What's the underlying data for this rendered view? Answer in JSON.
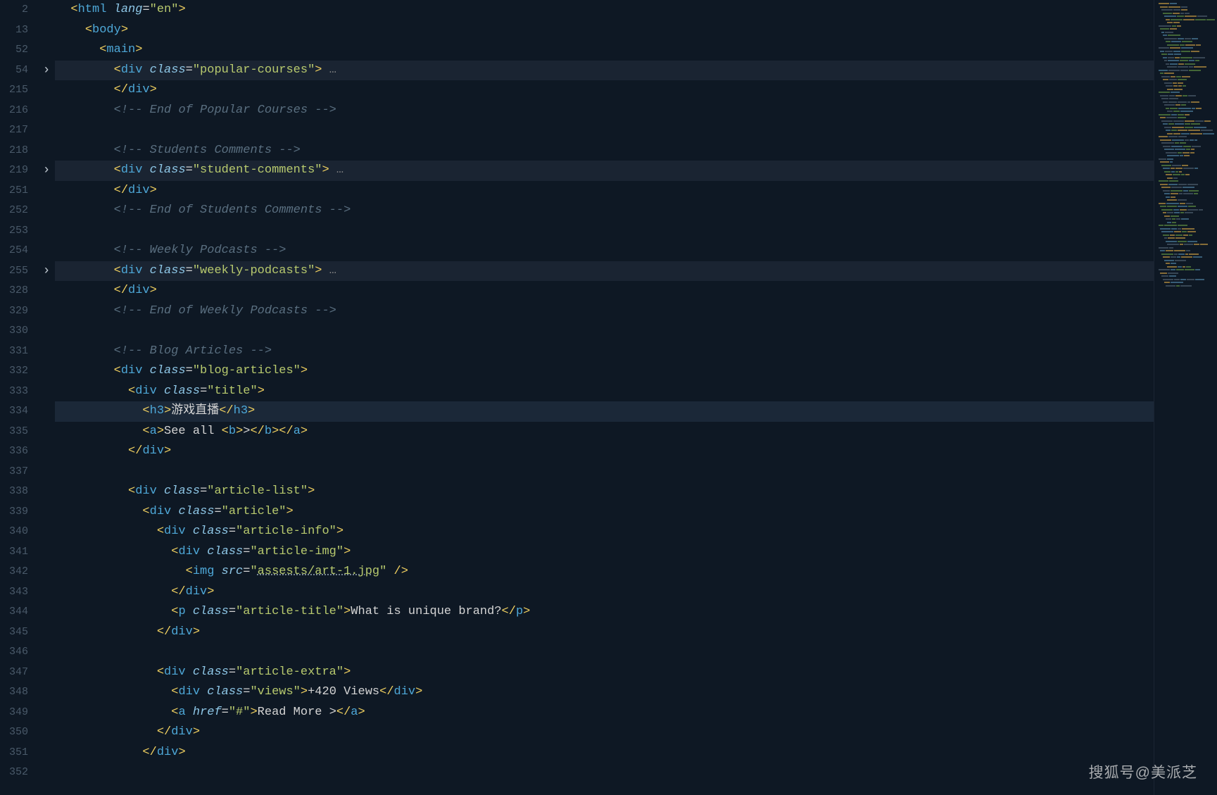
{
  "watermark": "搜狐号@美派芝",
  "lines": [
    {
      "num": "2",
      "fold": "",
      "indent": 1,
      "hl": false,
      "kind": "tag_attr",
      "tag": "html",
      "attr": "lang",
      "val": "en"
    },
    {
      "num": "13",
      "fold": "",
      "indent": 2,
      "hl": false,
      "kind": "open",
      "tag": "body"
    },
    {
      "num": "52",
      "fold": "",
      "indent": 3,
      "hl": false,
      "kind": "open",
      "tag": "main"
    },
    {
      "num": "54",
      "fold": ">",
      "indent": 4,
      "hl": true,
      "kind": "div_collapsed",
      "cls": "popular-courses"
    },
    {
      "num": "215",
      "fold": "",
      "indent": 4,
      "hl": false,
      "kind": "close",
      "tag": "div"
    },
    {
      "num": "216",
      "fold": "",
      "indent": 4,
      "hl": false,
      "kind": "comment",
      "text": "<!-- End of Popular Courses -->"
    },
    {
      "num": "217",
      "fold": "",
      "indent": 0,
      "hl": false,
      "kind": "blank"
    },
    {
      "num": "218",
      "fold": "",
      "indent": 4,
      "hl": false,
      "kind": "comment",
      "text": "<!-- Students Comments -->"
    },
    {
      "num": "219",
      "fold": ">",
      "indent": 4,
      "hl": true,
      "kind": "div_collapsed",
      "cls": "student-comments"
    },
    {
      "num": "251",
      "fold": "",
      "indent": 4,
      "hl": false,
      "kind": "close",
      "tag": "div"
    },
    {
      "num": "252",
      "fold": "",
      "indent": 4,
      "hl": false,
      "kind": "comment",
      "text": "<!-- End of Students Comments -->"
    },
    {
      "num": "253",
      "fold": "",
      "indent": 0,
      "hl": false,
      "kind": "blank"
    },
    {
      "num": "254",
      "fold": "",
      "indent": 4,
      "hl": false,
      "kind": "comment",
      "text": "<!-- Weekly Podcasts -->"
    },
    {
      "num": "255",
      "fold": ">",
      "indent": 4,
      "hl": true,
      "kind": "div_collapsed",
      "cls": "weekly-podcasts"
    },
    {
      "num": "328",
      "fold": "",
      "indent": 4,
      "hl": false,
      "kind": "close",
      "tag": "div"
    },
    {
      "num": "329",
      "fold": "",
      "indent": 4,
      "hl": false,
      "kind": "comment",
      "text": "<!-- End of Weekly Podcasts -->"
    },
    {
      "num": "330",
      "fold": "",
      "indent": 0,
      "hl": false,
      "kind": "blank"
    },
    {
      "num": "331",
      "fold": "",
      "indent": 4,
      "hl": false,
      "kind": "comment",
      "text": "<!-- Blog Articles -->"
    },
    {
      "num": "332",
      "fold": "",
      "indent": 4,
      "hl": false,
      "kind": "div_open",
      "cls": "blog-articles"
    },
    {
      "num": "333",
      "fold": "",
      "indent": 5,
      "hl": false,
      "kind": "div_open",
      "cls": "title"
    },
    {
      "num": "334",
      "fold": "",
      "indent": 6,
      "hl": true,
      "active": true,
      "kind": "h3",
      "text": "游戏直播"
    },
    {
      "num": "335",
      "fold": "",
      "indent": 6,
      "hl": false,
      "kind": "a_seeall",
      "text": "See all ",
      "bold": ">"
    },
    {
      "num": "336",
      "fold": "",
      "indent": 5,
      "hl": false,
      "kind": "close",
      "tag": "div"
    },
    {
      "num": "337",
      "fold": "",
      "indent": 0,
      "hl": false,
      "kind": "blank"
    },
    {
      "num": "338",
      "fold": "",
      "indent": 5,
      "hl": false,
      "kind": "div_open",
      "cls": "article-list"
    },
    {
      "num": "339",
      "fold": "",
      "indent": 6,
      "hl": false,
      "kind": "div_open",
      "cls": "article"
    },
    {
      "num": "340",
      "fold": "",
      "indent": 7,
      "hl": false,
      "kind": "div_open",
      "cls": "article-info"
    },
    {
      "num": "341",
      "fold": "",
      "indent": 8,
      "hl": false,
      "kind": "div_open",
      "cls": "article-img"
    },
    {
      "num": "342",
      "fold": "",
      "indent": 9,
      "hl": false,
      "kind": "img",
      "src": "assests/art-1.jpg"
    },
    {
      "num": "343",
      "fold": "",
      "indent": 8,
      "hl": false,
      "kind": "close",
      "tag": "div"
    },
    {
      "num": "344",
      "fold": "",
      "indent": 8,
      "hl": false,
      "kind": "p_title",
      "cls": "article-title",
      "text": "What is unique brand?"
    },
    {
      "num": "345",
      "fold": "",
      "indent": 7,
      "hl": false,
      "kind": "close",
      "tag": "div"
    },
    {
      "num": "346",
      "fold": "",
      "indent": 0,
      "hl": false,
      "kind": "blank"
    },
    {
      "num": "347",
      "fold": "",
      "indent": 7,
      "hl": false,
      "kind": "div_open",
      "cls": "article-extra"
    },
    {
      "num": "348",
      "fold": "",
      "indent": 8,
      "hl": false,
      "kind": "div_text",
      "cls": "views",
      "text": "+420 Views"
    },
    {
      "num": "349",
      "fold": "",
      "indent": 8,
      "hl": false,
      "kind": "a_href",
      "href": "#",
      "text": "Read More >"
    },
    {
      "num": "350",
      "fold": "",
      "indent": 7,
      "hl": false,
      "kind": "close",
      "tag": "div"
    },
    {
      "num": "351",
      "fold": "",
      "indent": 6,
      "hl": false,
      "kind": "close",
      "tag": "div"
    },
    {
      "num": "352",
      "fold": "",
      "indent": 0,
      "hl": false,
      "kind": "blank"
    }
  ]
}
